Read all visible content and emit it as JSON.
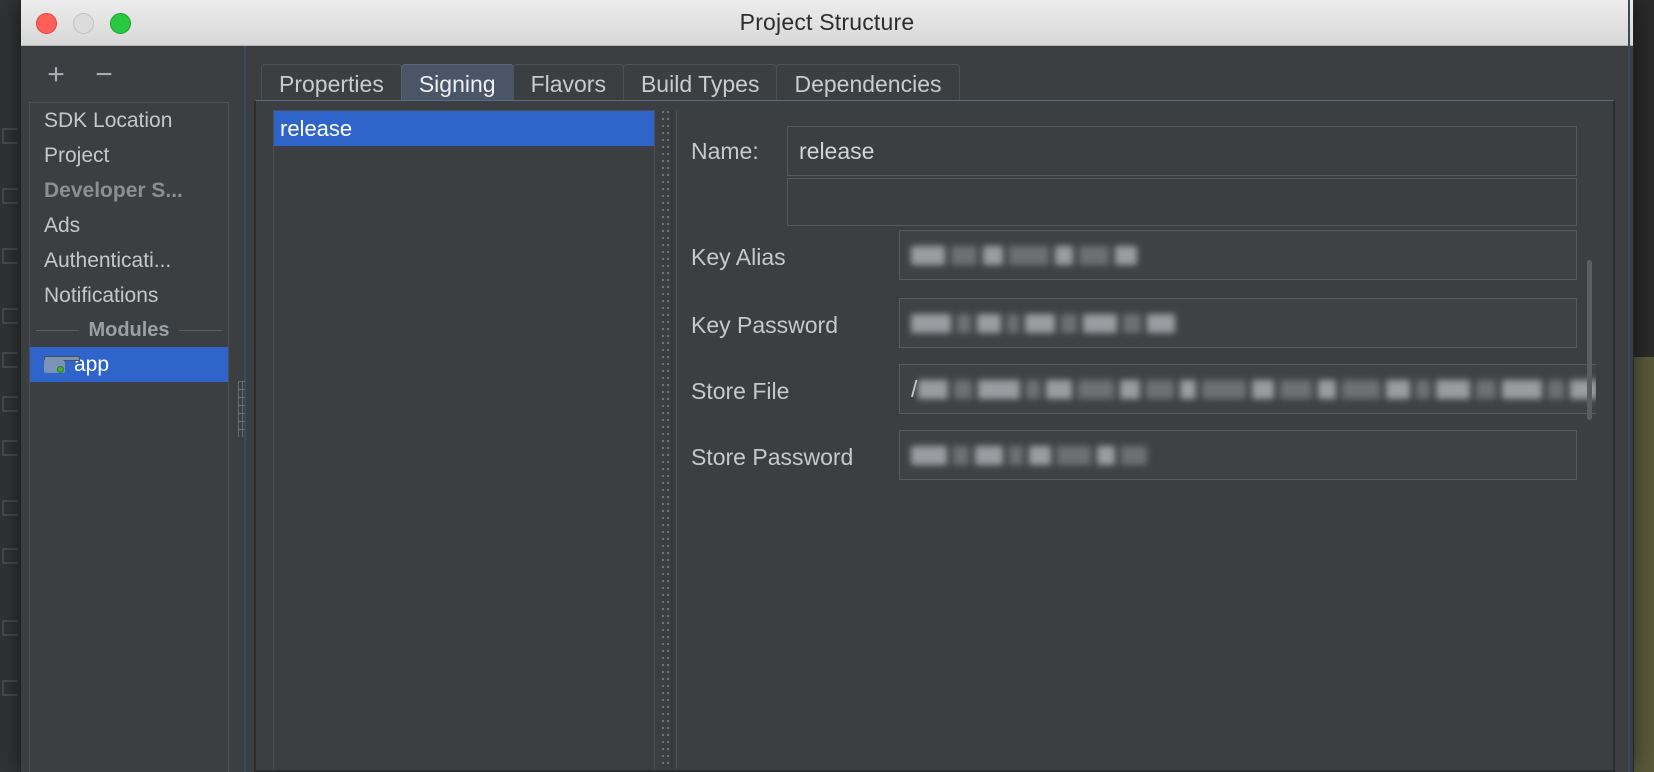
{
  "window": {
    "title": "Project Structure",
    "traffic_lights": [
      {
        "name": "close",
        "color": "#ff5f57"
      },
      {
        "name": "minimize",
        "color": "#dcdcdc"
      },
      {
        "name": "zoom",
        "color": "#28c840"
      }
    ]
  },
  "sidebar": {
    "toolbar": {
      "add_label": "+",
      "remove_label": "−"
    },
    "items": [
      {
        "label": "SDK Location",
        "state": "normal",
        "icon": ""
      },
      {
        "label": "Project",
        "state": "normal",
        "icon": ""
      },
      {
        "label": "Developer S...",
        "state": "dim",
        "icon": ""
      },
      {
        "label": "Ads",
        "state": "normal",
        "icon": ""
      },
      {
        "label": "Authenticati...",
        "state": "normal",
        "icon": ""
      },
      {
        "label": "Notifications",
        "state": "normal",
        "icon": ""
      }
    ],
    "group_label": "Modules",
    "modules": [
      {
        "label": "app",
        "selected": true,
        "icon": "folder-module-icon"
      }
    ]
  },
  "tabs": [
    {
      "label": "Properties",
      "active": false
    },
    {
      "label": "Signing",
      "active": true
    },
    {
      "label": "Flavors",
      "active": false
    },
    {
      "label": "Build Types",
      "active": false
    },
    {
      "label": "Dependencies",
      "active": false
    }
  ],
  "signing_list": [
    {
      "label": "release",
      "selected": true
    }
  ],
  "form": {
    "name": {
      "label": "Name:",
      "value": "release"
    },
    "fields": [
      {
        "label": "Key Alias",
        "value": "",
        "redacted": true,
        "prefix": "",
        "blocks": 7
      },
      {
        "label": "Key Password",
        "value": "",
        "redacted": true,
        "prefix": "",
        "blocks": 9
      },
      {
        "label": "Store File",
        "value": "",
        "redacted": true,
        "prefix": "/",
        "blocks": 26
      },
      {
        "label": "Store Password",
        "value": "",
        "redacted": true,
        "prefix": "",
        "blocks": 8
      }
    ]
  },
  "colors": {
    "selection_blue": "#2f65ca",
    "active_tab": "#4a5568",
    "panel_bg": "#3c3f41",
    "text": "#c5c8ca",
    "titlebar": "#e4e4e4"
  }
}
